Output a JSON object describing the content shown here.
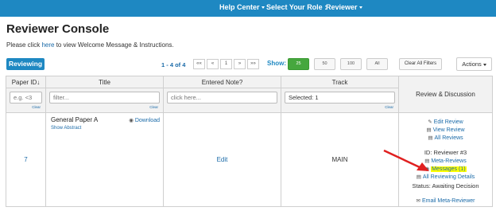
{
  "topnav": {
    "help_center": "Help Center",
    "role_label": "Select Your Role :",
    "role_value": "Reviewer"
  },
  "page": {
    "title": "Reviewer Console",
    "intro_prefix": "Please click ",
    "intro_link": "here",
    "intro_suffix": " to view Welcome Message & Instructions."
  },
  "toolbar": {
    "reviewing_label": "Reviewing",
    "paging_info": "1 - 4 of 4",
    "pager": {
      "first": "««",
      "prev": "«",
      "page": "1",
      "next": "»",
      "last": "»»"
    },
    "show_label": "Show:",
    "show_options": [
      "25",
      "50",
      "100",
      "All"
    ],
    "show_selected": "25",
    "clear_filters": "Clear All Filters",
    "actions": "Actions"
  },
  "table": {
    "headers": {
      "paper_id": "Paper ID↓",
      "title": "Title",
      "note": "Entered Note?",
      "track": "Track",
      "review": "Review & Discussion"
    },
    "filters": {
      "paper_id_placeholder": "e.g. <3",
      "title_placeholder": "filter...",
      "note_placeholder": "click here...",
      "track_value": "Selected: 1",
      "clear": "Clear"
    },
    "rows": [
      {
        "paper_id": "7",
        "title": "General Paper A",
        "show_abstract": "Show Abstract",
        "download": "Download",
        "note": "Edit",
        "track": "MAIN",
        "review": {
          "edit_review": "Edit Review",
          "view_review": "View Review",
          "all_reviews": "All Reviews",
          "reviewer_id": "ID: Reviewer #3",
          "meta_reviews": "Meta-Reviews",
          "messages": "Messages (1)",
          "all_reviewing_details": "All Reviewing Details",
          "status": "Status: Awaiting Decision",
          "email_meta": "Email Meta-Reviewer"
        }
      }
    ]
  },
  "colors": {
    "brand_blue": "#1e88c2",
    "active_green": "#46a73e",
    "highlight": "#ffff00",
    "annotation_arrow": "#e02020"
  }
}
